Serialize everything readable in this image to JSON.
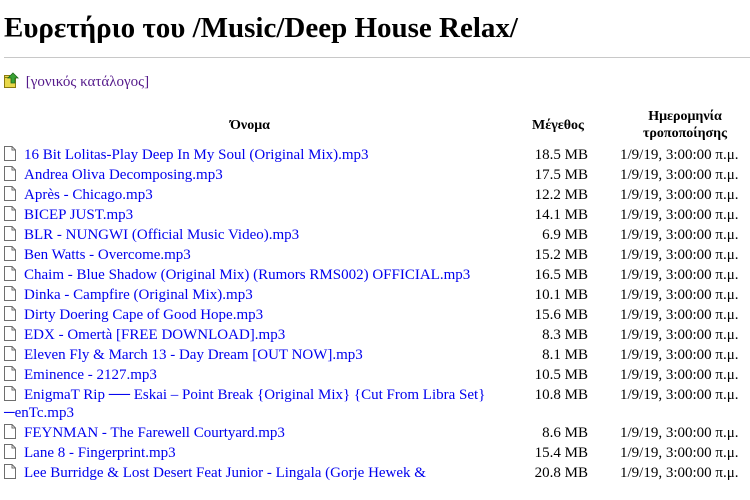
{
  "title": "Ευρετήριο του /Music/Deep House Relax/",
  "parent_link": {
    "icon": "up-folder-icon",
    "label": "[γονικός κατάλογος]"
  },
  "headers": {
    "name": "Όνομα",
    "size": "Μέγεθος",
    "date": "Ημερομηνία τροποποίησης"
  },
  "files": [
    {
      "name": "16 Bit Lolitas-Play Deep In My Soul (Original Mix).mp3",
      "size": "18.5 MB",
      "date": "1/9/19, 3:00:00 π.μ."
    },
    {
      "name": "Andrea Oliva Decomposing.mp3",
      "size": "17.5 MB",
      "date": "1/9/19, 3:00:00 π.μ."
    },
    {
      "name": "Après - Chicago.mp3",
      "size": "12.2 MB",
      "date": "1/9/19, 3:00:00 π.μ."
    },
    {
      "name": "BICEP JUST.mp3",
      "size": "14.1 MB",
      "date": "1/9/19, 3:00:00 π.μ."
    },
    {
      "name": "BLR - NUNGWI (Official Music Video).mp3",
      "size": "6.9 MB",
      "date": "1/9/19, 3:00:00 π.μ."
    },
    {
      "name": "Ben Watts - Overcome.mp3",
      "size": "15.2 MB",
      "date": "1/9/19, 3:00:00 π.μ."
    },
    {
      "name": "Chaim - Blue Shadow (Original Mix) (Rumors RMS002) OFFICIAL.mp3",
      "size": "16.5 MB",
      "date": "1/9/19, 3:00:00 π.μ."
    },
    {
      "name": "Dinka - Campfire (Original Mix).mp3",
      "size": "10.1 MB",
      "date": "1/9/19, 3:00:00 π.μ."
    },
    {
      "name": "Dirty Doering Cape of Good Hope.mp3",
      "size": "15.6 MB",
      "date": "1/9/19, 3:00:00 π.μ."
    },
    {
      "name": "EDX - Omertà [FREE DOWNLOAD].mp3",
      "size": "8.3 MB",
      "date": "1/9/19, 3:00:00 π.μ."
    },
    {
      "name": "Eleven Fly & March 13 - Day Dream [OUT NOW].mp3",
      "size": "8.1 MB",
      "date": "1/9/19, 3:00:00 π.μ."
    },
    {
      "name": "Eminence - 2127.mp3",
      "size": "10.5 MB",
      "date": "1/9/19, 3:00:00 π.μ."
    },
    {
      "name": "EnigmaT Rip ── Eskai – Point Break {Original Mix} {Cut From Libra Set}─enTc.mp3",
      "size": "10.8 MB",
      "date": "1/9/19, 3:00:00 π.μ."
    },
    {
      "name": "FEYNMAN - The Farewell Courtyard.mp3",
      "size": "8.6 MB",
      "date": "1/9/19, 3:00:00 π.μ."
    },
    {
      "name": "Lane 8 - Fingerprint.mp3",
      "size": "15.4 MB",
      "date": "1/9/19, 3:00:00 π.μ."
    },
    {
      "name": "Lee Burridge & Lost Desert Feat Junior - Lingala (Gorje Hewek &",
      "size": "20.8 MB",
      "date": "1/9/19, 3:00:00 π.μ."
    }
  ],
  "colors": {
    "link": "#0000ee",
    "visited_link": "#551a8b",
    "rule": "#c8c8c8"
  }
}
